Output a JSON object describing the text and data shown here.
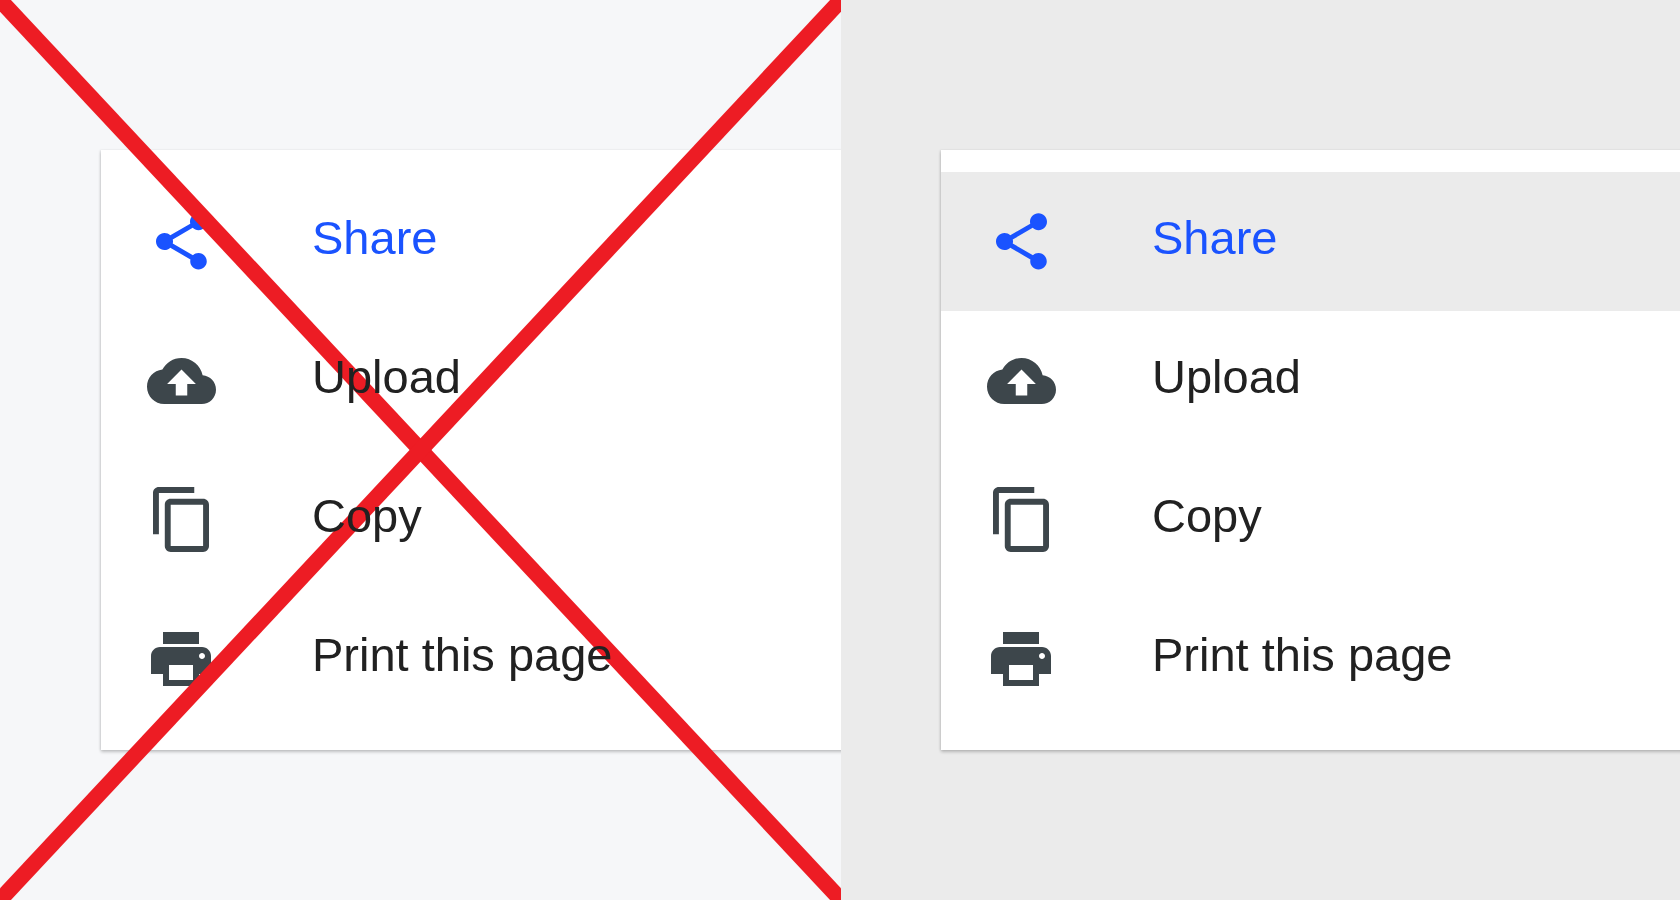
{
  "panels": [
    {
      "crossed_out": true,
      "selected_background": false,
      "menu": {
        "items": [
          {
            "label": "Share",
            "selected": true
          },
          {
            "label": "Upload",
            "selected": false
          },
          {
            "label": "Copy",
            "selected": false
          },
          {
            "label": "Print this page",
            "selected": false
          }
        ]
      }
    },
    {
      "crossed_out": false,
      "selected_background": true,
      "menu": {
        "items": [
          {
            "label": "Share",
            "selected": true
          },
          {
            "label": "Upload",
            "selected": false
          },
          {
            "label": "Copy",
            "selected": false
          },
          {
            "label": "Print this page",
            "selected": false
          }
        ]
      }
    }
  ]
}
